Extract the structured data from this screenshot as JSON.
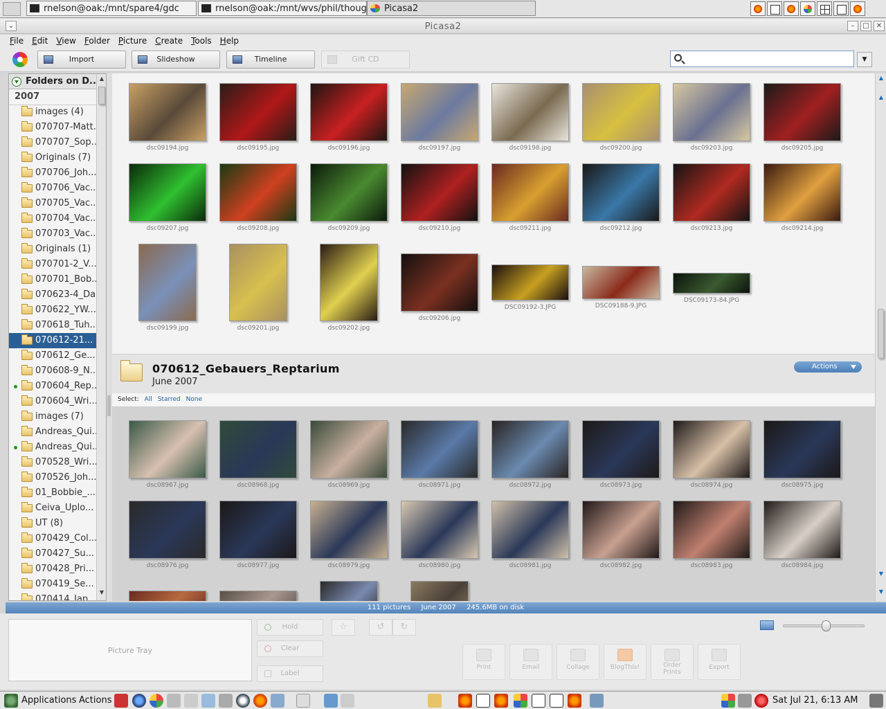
{
  "taskbar_top": {
    "tasks": [
      {
        "label": "rnelson@oak:/mnt/spare4/gdc"
      },
      {
        "label": "rnelson@oak:/mnt/wvs/phil/thoughtlet"
      },
      {
        "label": "Picasa2"
      }
    ]
  },
  "window": {
    "title": "Picasa2"
  },
  "menu": [
    "File",
    "Edit",
    "View",
    "Folder",
    "Picture",
    "Create",
    "Tools",
    "Help"
  ],
  "toolbar": {
    "import": "Import",
    "slideshow": "Slideshow",
    "timeline": "Timeline",
    "giftcd": "Gift CD",
    "search_placeholder": ""
  },
  "sidebar": {
    "header": "Folders on D...",
    "year": "2007",
    "items": [
      {
        "label": "images (4)",
        "dot": false
      },
      {
        "label": "070707-Matt...",
        "dot": false
      },
      {
        "label": "070707_Sop...",
        "dot": false
      },
      {
        "label": "Originals (7)",
        "dot": false
      },
      {
        "label": "070706_Joh...",
        "dot": false
      },
      {
        "label": "070706_Vac...",
        "dot": false
      },
      {
        "label": "070705_Vac...",
        "dot": false
      },
      {
        "label": "070704_Vac...",
        "dot": false
      },
      {
        "label": "070703_Vac...",
        "dot": false
      },
      {
        "label": "Originals (1)",
        "dot": false
      },
      {
        "label": "070701-2_V...",
        "dot": false
      },
      {
        "label": "070701_Bob...",
        "dot": false
      },
      {
        "label": "070623-4_Da...",
        "dot": false
      },
      {
        "label": "070622_YW...",
        "dot": false
      },
      {
        "label": "070618_Tuh...",
        "dot": false
      },
      {
        "label": "070612-21...",
        "dot": false,
        "selected": true
      },
      {
        "label": "070612_Ge...",
        "dot": false
      },
      {
        "label": "070608-9_N...",
        "dot": false
      },
      {
        "label": "070604_Rep...",
        "dot": true
      },
      {
        "label": "070604_Wri...",
        "dot": false
      },
      {
        "label": "images (7)",
        "dot": false
      },
      {
        "label": "Andreas_Qui...",
        "dot": false
      },
      {
        "label": "Andreas_Qui...",
        "dot": true
      },
      {
        "label": "070528_Wri...",
        "dot": false
      },
      {
        "label": "070526_Joh...",
        "dot": false
      },
      {
        "label": "01_Bobbie_...",
        "dot": false
      },
      {
        "label": "Ceiva_Uplo...",
        "dot": false
      },
      {
        "label": "UT (8)",
        "dot": false
      },
      {
        "label": "070429_Col...",
        "dot": false
      },
      {
        "label": "070427_Su...",
        "dot": false
      },
      {
        "label": "070428_Pri...",
        "dot": false
      },
      {
        "label": "070419_Se...",
        "dot": false
      },
      {
        "label": "070414_Jap...",
        "dot": false
      }
    ]
  },
  "upper_grid": {
    "photos": [
      {
        "name": "dsc09194.jpg",
        "colors": [
          "#c8a064",
          "#5a4a3a"
        ]
      },
      {
        "name": "dsc09195.jpg",
        "colors": [
          "#2a1c18",
          "#b01818"
        ]
      },
      {
        "name": "dsc09196.jpg",
        "colors": [
          "#1f1612",
          "#c82020"
        ]
      },
      {
        "name": "dsc09197.jpg",
        "colors": [
          "#c8a870",
          "#6b7aa0"
        ]
      },
      {
        "name": "dsc09198.jpg",
        "colors": [
          "#e8e4dc",
          "#7a6a50"
        ]
      },
      {
        "name": "dsc09200.jpg",
        "colors": [
          "#a89070",
          "#d8c040"
        ]
      },
      {
        "name": "dsc09203.jpg",
        "colors": [
          "#d8c8a0",
          "#6a7090"
        ]
      },
      {
        "name": "dsc09205.jpg",
        "colors": [
          "#1c1a1a",
          "#a02020"
        ]
      },
      {
        "name": "dsc09207.jpg",
        "colors": [
          "#0a2a0a",
          "#30c030"
        ]
      },
      {
        "name": "dsc09208.jpg",
        "colors": [
          "#1a3a14",
          "#d04020"
        ]
      },
      {
        "name": "dsc09209.jpg",
        "colors": [
          "#0c1a0c",
          "#4a8a30"
        ]
      },
      {
        "name": "dsc09210.jpg",
        "colors": [
          "#121212",
          "#b02020"
        ]
      },
      {
        "name": "dsc09211.jpg",
        "colors": [
          "#6a2a20",
          "#d8a030"
        ]
      },
      {
        "name": "dsc09212.jpg",
        "colors": [
          "#1a1818",
          "#3a78a8"
        ]
      },
      {
        "name": "dsc09213.jpg",
        "colors": [
          "#161414",
          "#b02a20"
        ]
      },
      {
        "name": "dsc09214.jpg",
        "colors": [
          "#3a1a10",
          "#e0a040"
        ]
      },
      {
        "name": "dsc09199.jpg",
        "colors": [
          "#8a6a50",
          "#7a90b8"
        ]
      },
      {
        "name": "dsc09201.jpg",
        "colors": [
          "#a89060",
          "#d8c050"
        ]
      },
      {
        "name": "dsc09202.jpg",
        "colors": [
          "#2a1c14",
          "#e0d050"
        ]
      },
      {
        "name": "dsc09206.jpg",
        "colors": [
          "#141010",
          "#7a3020"
        ]
      },
      {
        "name": "DSC09192-3.JPG",
        "colors": [
          "#1a1010",
          "#c8a020"
        ]
      },
      {
        "name": "DSC09188-9.JPG",
        "colors": [
          "#c8b8a0",
          "#8a2a1a"
        ]
      },
      {
        "name": "DSC09173-84.JPG",
        "colors": [
          "#0c140c",
          "#3a5a30"
        ]
      }
    ]
  },
  "album": {
    "title": "070612_Gebauers_Reptarium",
    "date": "June 2007",
    "actions_label": "Actions",
    "select_label": "Select:",
    "select_all": "All",
    "select_starred": "Starred",
    "select_none": "None"
  },
  "lower_grid": {
    "photos": [
      {
        "name": "dsc08967.jpg",
        "colors": [
          "#3a5a48",
          "#d8c0b0"
        ]
      },
      {
        "name": "dsc08968.jpg",
        "colors": [
          "#304a3a",
          "#2a3858"
        ]
      },
      {
        "name": "dsc08969.jpg",
        "colors": [
          "#3a4a3a",
          "#c8b0a0"
        ]
      },
      {
        "name": "dsc08971.jpg",
        "colors": [
          "#2a2a2a",
          "#5a7aa8"
        ]
      },
      {
        "name": "dsc08972.jpg",
        "colors": [
          "#2a2422",
          "#6a8ab0"
        ]
      },
      {
        "name": "dsc08973.jpg",
        "colors": [
          "#1e1a18",
          "#2a3858"
        ]
      },
      {
        "name": "dsc08974.jpg",
        "colors": [
          "#1e1a18",
          "#d8c0a8"
        ]
      },
      {
        "name": "dsc08975.jpg",
        "colors": [
          "#1c1818",
          "#2a3858"
        ]
      },
      {
        "name": "dsc08976.jpg",
        "colors": [
          "#2a2a2a",
          "#2a3858"
        ]
      },
      {
        "name": "dsc08977.jpg",
        "colors": [
          "#1c1818",
          "#2a3858"
        ]
      },
      {
        "name": "dsc08979.jpg",
        "colors": [
          "#c8b090",
          "#2a3858"
        ]
      },
      {
        "name": "dsc08980.jpg",
        "colors": [
          "#d8c8b0",
          "#2a3858"
        ]
      },
      {
        "name": "dsc08981.jpg",
        "colors": [
          "#d0c0a8",
          "#2a3858"
        ]
      },
      {
        "name": "dsc08982.jpg",
        "colors": [
          "#201818",
          "#c8a090"
        ]
      },
      {
        "name": "dsc08983.jpg",
        "colors": [
          "#201a18",
          "#c08070"
        ]
      },
      {
        "name": "dsc08984.jpg",
        "colors": [
          "#201a18",
          "#d8d0c8"
        ]
      },
      {
        "name": "",
        "colors": [
          "#6a2a20",
          "#b86a40"
        ]
      },
      {
        "name": "",
        "colors": [
          "#5a5048",
          "#a89890"
        ]
      },
      {
        "name": "",
        "colors": [
          "#2a2a2a",
          "#7a8ab0"
        ]
      },
      {
        "name": "",
        "colors": [
          "#8a7a60",
          "#4a4038"
        ]
      }
    ]
  },
  "status": {
    "pictures": "111 pictures",
    "date": "June 2007",
    "size": "245.6MB on disk"
  },
  "bottom": {
    "tray_label": "Picture Tray",
    "hold": "Hold",
    "clear": "Clear",
    "label": "Label",
    "zoom_fraction": 0.52,
    "actions": [
      "Print",
      "Email",
      "Collage",
      "BlogThis!",
      "Order Prints",
      "Export"
    ]
  },
  "taskbar_bottom": {
    "applications": "Applications",
    "actions": "Actions",
    "clock": "Sat Jul 21,  6:13 AM"
  }
}
